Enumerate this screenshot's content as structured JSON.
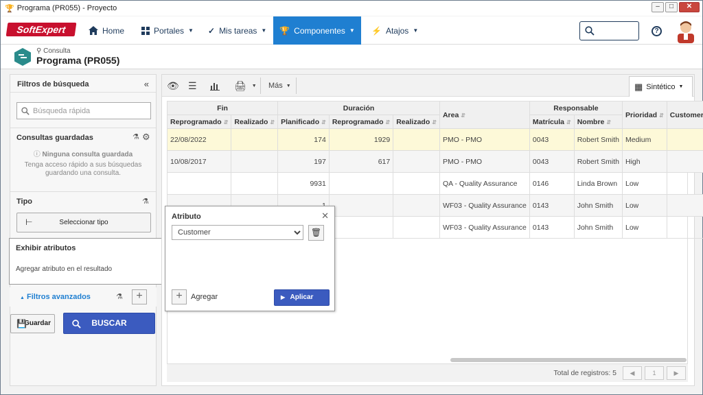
{
  "window": {
    "title": "Programa (PR055) - Proyecto"
  },
  "nav": {
    "logo": "SoftExpert",
    "items": [
      {
        "label": "Home",
        "icon": "home-icon"
      },
      {
        "label": "Portales",
        "icon": "grid-icon"
      },
      {
        "label": "Mis tareas",
        "icon": "check-icon"
      },
      {
        "label": "Componentes",
        "icon": "trophy-icon",
        "active": true
      },
      {
        "label": "Atajos",
        "icon": "bolt-icon"
      }
    ],
    "accent": "#1f7fd1"
  },
  "page": {
    "subtitle": "Consulta",
    "title": "Programa (PR055)"
  },
  "filters": {
    "title": "Filtros de búsqueda",
    "quick_search_placeholder": "Búsqueda rápida",
    "saved_title": "Consultas guardadas",
    "saved_none": "Ninguna consulta guardada",
    "saved_hint_1": "Tenga acceso rápido a sus búsquedas",
    "saved_hint_2": "guardando una consulta.",
    "type_title": "Tipo",
    "select_type": "Seleccionar tipo",
    "attrs_title": "Exhibir atributos",
    "attrs_hint": "Agregar atributo en el resultado",
    "advanced": "Filtros avanzados",
    "save": "Guardar",
    "search": "BUSCAR"
  },
  "toolbar": {
    "more": "Más",
    "view": "Sintético"
  },
  "grid": {
    "groups": {
      "fin": "Fin",
      "duracion": "Duración",
      "responsable": "Responsable"
    },
    "headers": {
      "reprogramado": "Reprogramado",
      "realizado": "Realizado",
      "planificado": "Planificado",
      "reprogramado2": "Reprogramado",
      "realizado2": "Realizado",
      "area": "Area",
      "matricula": "Matrícula",
      "nombre": "Nombre",
      "prioridad": "Prioridad",
      "customer": "Customer"
    },
    "rows": [
      {
        "fin_rep": "22/08/2022",
        "fin_real": "",
        "plan": "174",
        "dur_rep": "1929",
        "dur_real": "",
        "area": "PMO - PMO",
        "mat": "0043",
        "nombre": "Robert Smith",
        "prio": "Medium",
        "cust": ""
      },
      {
        "fin_rep": "10/08/2017",
        "fin_real": "",
        "plan": "197",
        "dur_rep": "617",
        "dur_real": "",
        "area": "PMO - PMO",
        "mat": "0043",
        "nombre": "Robert Smith",
        "prio": "High",
        "cust": ""
      },
      {
        "fin_rep": "",
        "fin_real": "",
        "plan": "9931",
        "dur_rep": "",
        "dur_real": "",
        "area": "QA - Quality Assurance",
        "mat": "0146",
        "nombre": "Linda Brown",
        "prio": "Low",
        "cust": ""
      },
      {
        "fin_rep": "",
        "fin_real": "",
        "plan": "1",
        "dur_rep": "",
        "dur_real": "",
        "area": "WF03 - Quality Assurance",
        "mat": "0143",
        "nombre": "John Smith",
        "prio": "Low",
        "cust": ""
      },
      {
        "fin_rep": "",
        "fin_real": "",
        "plan": "",
        "dur_rep": "",
        "dur_real": "",
        "area": "WF03 - Quality Assurance",
        "mat": "0143",
        "nombre": "John Smith",
        "prio": "Low",
        "cust": ""
      }
    ],
    "total": "Total de registros: 5",
    "page": "1"
  },
  "popup": {
    "title": "Atributo",
    "selected": "Customer",
    "add": "Agregar",
    "apply": "Aplicar"
  }
}
